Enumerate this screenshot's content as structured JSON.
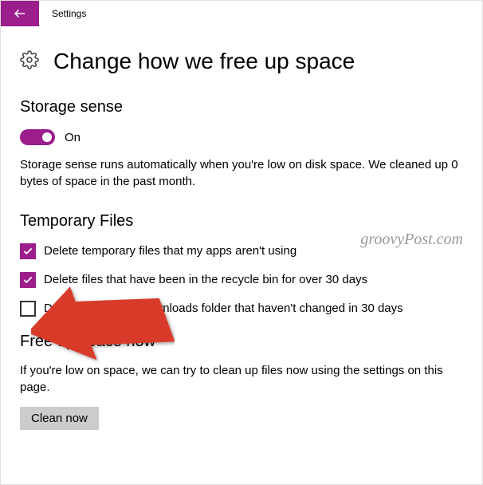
{
  "header": {
    "title": "Settings"
  },
  "page": {
    "heading": "Change how we free up space"
  },
  "storage_sense": {
    "title": "Storage sense",
    "toggle_state": "On",
    "description": "Storage sense runs automatically when you're low on disk space. We cleaned up 0 bytes of space in the past month."
  },
  "temp_files": {
    "title": "Temporary Files",
    "items": [
      {
        "checked": true,
        "label": "Delete temporary files that my apps aren't using"
      },
      {
        "checked": true,
        "label": "Delete files that have been in the recycle bin for over 30 days"
      },
      {
        "checked": false,
        "label": "Delete files in the Downloads folder that haven't changed in 30 days"
      }
    ]
  },
  "free_up": {
    "title": "Free up space now",
    "description": "If you're low on space, we can try to clean up files now using the settings on this page.",
    "button": "Clean now"
  },
  "watermark": "groovyPost.com",
  "colors": {
    "accent": "#9b1e8c"
  }
}
